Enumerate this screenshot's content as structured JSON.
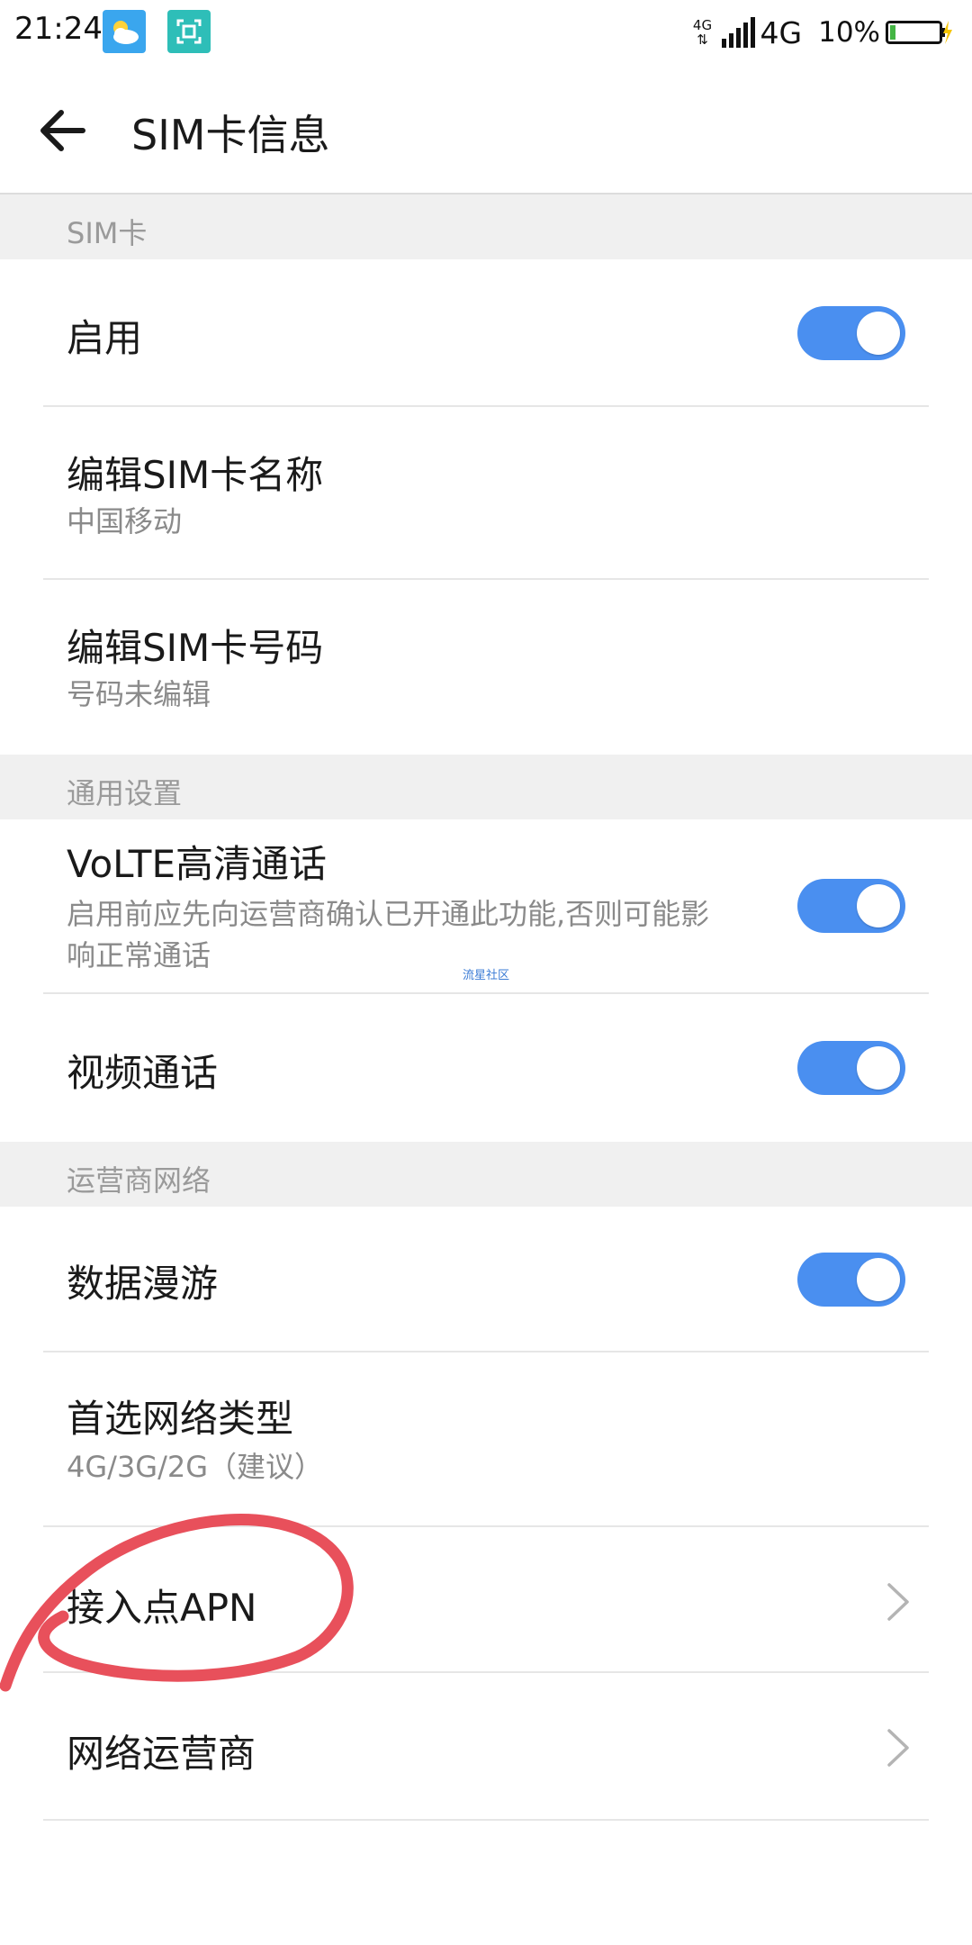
{
  "status_bar": {
    "time": "21:24",
    "network_small": "4G",
    "network": "4G",
    "battery": "10%",
    "icons": [
      "weather-icon",
      "scan-icon",
      "signal-icon",
      "battery-icon"
    ]
  },
  "header": {
    "title": "SIM卡信息"
  },
  "sections": {
    "sim": {
      "header": "SIM卡",
      "enable": {
        "title": "启用",
        "toggle_on": true
      },
      "edit_name": {
        "title": "编辑SIM卡名称",
        "subtitle": "中国移动"
      },
      "edit_number": {
        "title": "编辑SIM卡号码",
        "subtitle": "号码未编辑"
      }
    },
    "general": {
      "header": "通用设置",
      "volte": {
        "title": "VoLTE高清通话",
        "subtitle": "启用前应先向运营商确认已开通此功能,否则可能影响正常通话",
        "toggle_on": true
      },
      "video_call": {
        "title": "视频通话",
        "toggle_on": true
      }
    },
    "carrier": {
      "header": "运营商网络",
      "data_roaming": {
        "title": "数据漫游",
        "toggle_on": true
      },
      "preferred_network": {
        "title": "首选网络类型",
        "subtitle": "4G/3G/2G（建议）"
      },
      "apn": {
        "title": "接入点APN"
      },
      "operator": {
        "title": "网络运营商"
      }
    }
  },
  "watermark": "流星社区",
  "colors": {
    "toggle_on": "#4a8ff0",
    "section_bg": "#f0f0f0",
    "annotation": "#e8505b"
  }
}
